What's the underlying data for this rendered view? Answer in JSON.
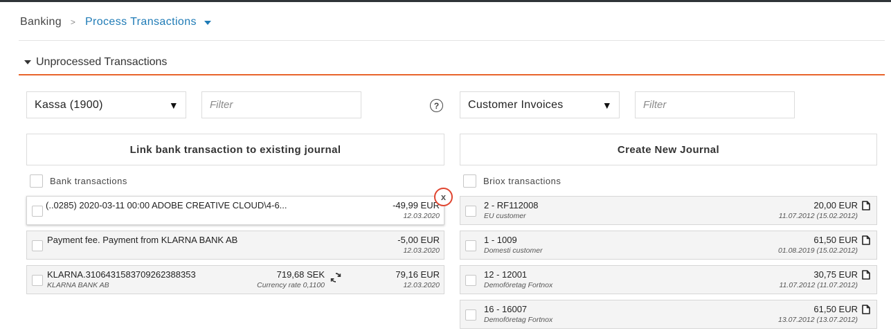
{
  "breadcrumb": {
    "root": "Banking",
    "separator": ">",
    "current": "Process Transactions"
  },
  "section": {
    "title": "Unprocessed Transactions",
    "accent_color": "#e8632b"
  },
  "left": {
    "account_select": "Kassa (1900)",
    "filter_placeholder": "Filter",
    "action_button": "Link bank transaction to existing journal",
    "list_header": "Bank transactions",
    "close_label": "x",
    "transactions": [
      {
        "description": "(..0285) 2020-03-11 00:00 ADOBE CREATIVE CLOUD\\4-6...",
        "amount": "-49,99 EUR",
        "date": "12.03.2020"
      },
      {
        "description": "Payment fee. Payment from KLARNA BANK AB",
        "amount": "-5,00 EUR",
        "date": "12.03.2020"
      },
      {
        "description": "KLARNA.31064315837092623883​53",
        "subtitle": "KLARNA BANK AB",
        "foreign_amount": "719,68 SEK",
        "currency_rate": "Currency rate 0,1100",
        "amount": "79,16 EUR",
        "date": "12.03.2020"
      }
    ]
  },
  "right": {
    "type_select": "Customer Invoices",
    "filter_placeholder": "Filter",
    "action_button": "Create New Journal",
    "list_header": "Briox transactions",
    "transactions": [
      {
        "title": "2 - RF112008",
        "subtitle": "EU customer",
        "amount": "20,00 EUR",
        "date": "11.07.2012 (15.02.2012)"
      },
      {
        "title": "1 - 1009",
        "subtitle": "Domesti customer",
        "amount": "61,50 EUR",
        "date": "01.08.2019 (15.02.2012)"
      },
      {
        "title": "12 - 12001",
        "subtitle": "Demoföretag Fortnox",
        "amount": "30,75 EUR",
        "date": "11.07.2012 (11.07.2012)"
      },
      {
        "title": "16 - 16007",
        "subtitle": "Demoföretag Fortnox",
        "amount": "61,50 EUR",
        "date": "13.07.2012 (13.07.2012)"
      }
    ]
  },
  "icons": {
    "help": "question-circle-icon",
    "select_arrow": "triangle-down-icon",
    "refresh": "refresh-icon",
    "document": "document-icon"
  }
}
